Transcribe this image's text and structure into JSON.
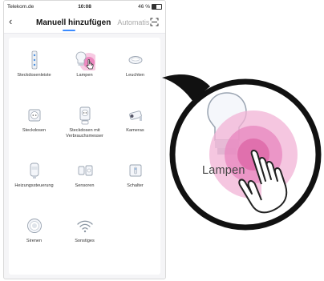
{
  "statusbar": {
    "carrier": "Telekom.de",
    "time": "10:08",
    "battery": "46 %"
  },
  "navbar": {
    "back_icon": "chevron-left-icon",
    "tab_manual": "Manuell hinzufügen",
    "tab_auto": "Automatis",
    "scan_icon": "scan-icon",
    "accent": "#3b8bff"
  },
  "categories": [
    {
      "label": "Steckdosenleiste",
      "icon": "power-strip-icon"
    },
    {
      "label": "Lampen",
      "icon": "bulb-icon"
    },
    {
      "label": "Leuchten",
      "icon": "ceiling-light-icon"
    },
    {
      "label": "Steckdosen",
      "icon": "socket-icon"
    },
    {
      "label": "Steckdosen mit Verbrauchsmesser",
      "icon": "energy-socket-icon"
    },
    {
      "label": "Kameras",
      "icon": "camera-icon"
    },
    {
      "label": "Heizungssteuerung",
      "icon": "thermostat-icon"
    },
    {
      "label": "Sensoren",
      "icon": "sensor-icon"
    },
    {
      "label": "Schalter",
      "icon": "switch-icon"
    },
    {
      "label": "Sirenen",
      "icon": "siren-icon"
    },
    {
      "label": "Sonstiges",
      "icon": "wifi-icon"
    }
  ],
  "zoom": {
    "label": "Lampen",
    "tap_color": "#e0509a"
  }
}
